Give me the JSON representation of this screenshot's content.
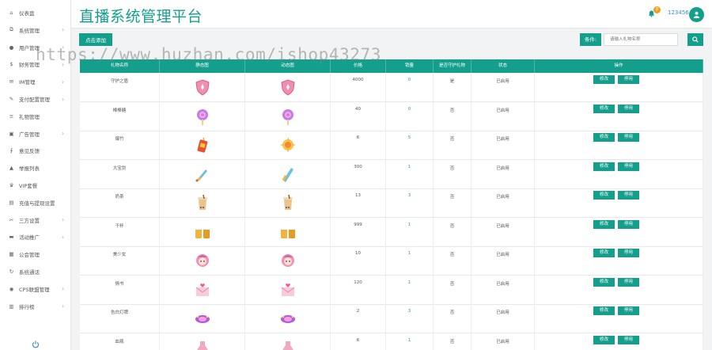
{
  "header": {
    "title": "直播系统管理平台",
    "notify_count": "0",
    "username": "123456"
  },
  "sidebar": {
    "items": [
      {
        "label": "仪表盘",
        "icon": "home-icon",
        "chev": false
      },
      {
        "label": "系统管理",
        "icon": "sitemap-icon",
        "chev": true
      },
      {
        "label": "用户管理",
        "icon": "user-icon",
        "chev": true
      },
      {
        "label": "财务管理",
        "icon": "dollar-icon",
        "chev": true
      },
      {
        "label": "IM管理",
        "icon": "message-icon",
        "chev": true
      },
      {
        "label": "支付配置管理",
        "icon": "wrench-icon",
        "chev": true
      },
      {
        "label": "礼物管理",
        "icon": "list-icon",
        "chev": false
      },
      {
        "label": "广告管理",
        "icon": "ad-icon",
        "chev": true
      },
      {
        "label": "意见反馈",
        "icon": "paperclip-icon",
        "chev": false
      },
      {
        "label": "举报列表",
        "icon": "warning-icon",
        "chev": false
      },
      {
        "label": "VIP套餐",
        "icon": "vip-icon",
        "chev": false
      },
      {
        "label": "充值与提现设置",
        "icon": "file-icon",
        "chev": false
      },
      {
        "label": "三方设置",
        "icon": "tool-icon",
        "chev": true
      },
      {
        "label": "活动推广",
        "icon": "briefcase-icon",
        "chev": true
      },
      {
        "label": "公会管理",
        "icon": "grid-icon",
        "chev": false
      },
      {
        "label": "系统通话",
        "icon": "refresh-icon",
        "chev": false
      },
      {
        "label": "CPS联盟管理",
        "icon": "globe-icon",
        "chev": true
      },
      {
        "label": "排行榜",
        "icon": "chart-icon",
        "chev": true
      }
    ]
  },
  "toolbar": {
    "add_label": "点击添加",
    "search_label": "条件:",
    "search_placeholder": "请输入礼物名称"
  },
  "watermark": "https://www.huzhan.com/ishop43273",
  "table": {
    "headers": [
      "礼物名称",
      "静态图",
      "动态图",
      "价格",
      "销量",
      "是否守护礼物",
      "状态",
      "操作"
    ],
    "edit_label": "修改",
    "disable_label": "停用",
    "rows": [
      {
        "name": "守护之盾",
        "price": "4000",
        "sales": "0",
        "guard": "是",
        "status": "已启用",
        "icon": "shield-gift-icon"
      },
      {
        "name": "棒棒糖",
        "price": "40",
        "sales": "0",
        "guard": "否",
        "status": "已启用",
        "icon": "lollipop-gift-icon"
      },
      {
        "name": "爆竹",
        "price": "6",
        "sales": "5",
        "guard": "否",
        "status": "已启用",
        "icon": "firecracker-gift-icon"
      },
      {
        "name": "大宝剑",
        "price": "300",
        "sales": "1",
        "guard": "否",
        "status": "已启用",
        "icon": "sword-gift-icon"
      },
      {
        "name": "奶茶",
        "price": "13",
        "sales": "3",
        "guard": "否",
        "status": "已启用",
        "icon": "milktea-gift-icon"
      },
      {
        "name": "干杯",
        "price": "999",
        "sales": "1",
        "guard": "否",
        "status": "已启用",
        "icon": "cheers-gift-icon"
      },
      {
        "name": "美少女",
        "price": "10",
        "sales": "1",
        "guard": "否",
        "status": "已启用",
        "icon": "girl-gift-icon"
      },
      {
        "name": "情书",
        "price": "120",
        "sales": "1",
        "guard": "否",
        "status": "已启用",
        "icon": "loveletter-gift-icon"
      },
      {
        "name": "告白灯牌",
        "price": "2",
        "sales": "3",
        "guard": "否",
        "status": "已启用",
        "icon": "lightsign-gift-icon"
      },
      {
        "name": "血瓶",
        "price": "6",
        "sales": "1",
        "guard": "否",
        "status": "已启用",
        "icon": "potion-gift-icon"
      }
    ]
  },
  "colors": {
    "accent": "#139f8b",
    "link": "#3b8bd8",
    "badge": "#f0a020"
  }
}
